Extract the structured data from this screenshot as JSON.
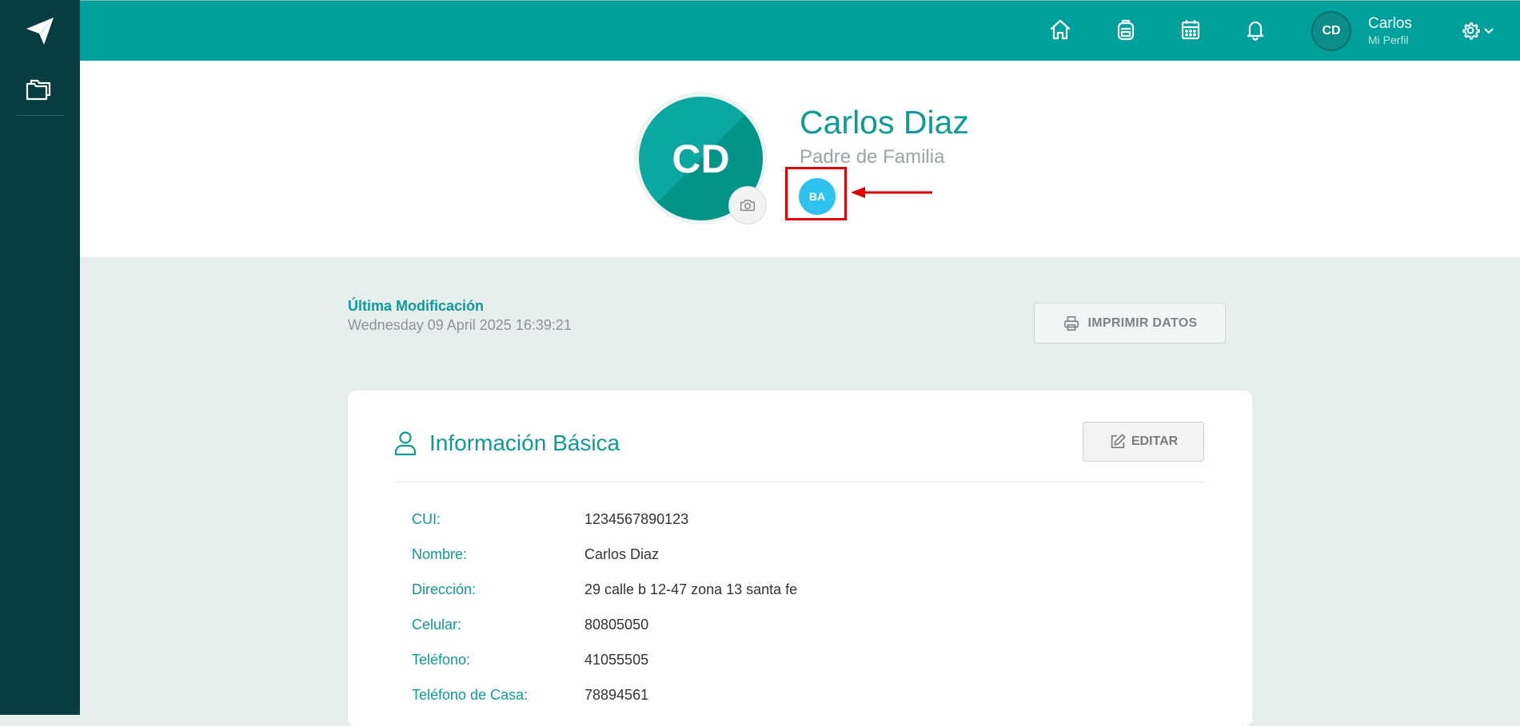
{
  "topbar": {
    "user": {
      "initials": "CD",
      "name": "Carlos",
      "subtitle": "Mi Perfil"
    }
  },
  "profile": {
    "initials": "CD",
    "name": "Carlos Diaz",
    "role": "Padre de Familia",
    "badge": "BA"
  },
  "modified": {
    "label": "Última Modificación",
    "value": "Wednesday 09 April 2025 16:39:21"
  },
  "print_button": {
    "label": "IMPRIMIR DATOS"
  },
  "basic_info": {
    "title": "Información Básica",
    "edit_label": "EDITAR",
    "fields": [
      {
        "key": "CUI:",
        "value": "1234567890123"
      },
      {
        "key": "Nombre:",
        "value": "Carlos Diaz"
      },
      {
        "key": "Dirección:",
        "value": "29 calle b 12-47 zona 13 santa fe"
      },
      {
        "key": "Celular:",
        "value": "80805050"
      },
      {
        "key": "Teléfono:",
        "value": "41055505"
      },
      {
        "key": "Teléfono de Casa:",
        "value": "78894561"
      }
    ]
  },
  "colors": {
    "primary": "#00a19c",
    "sidebar": "#053d40",
    "badge": "#2ec3ef",
    "highlight": "#e00000"
  },
  "icons": {
    "sidebar": [
      "paper-plane-icon",
      "folders-icon"
    ],
    "nav": [
      "home-icon",
      "backpack-icon",
      "calendar-icon",
      "bell-icon"
    ],
    "settings": "gear-icon"
  }
}
